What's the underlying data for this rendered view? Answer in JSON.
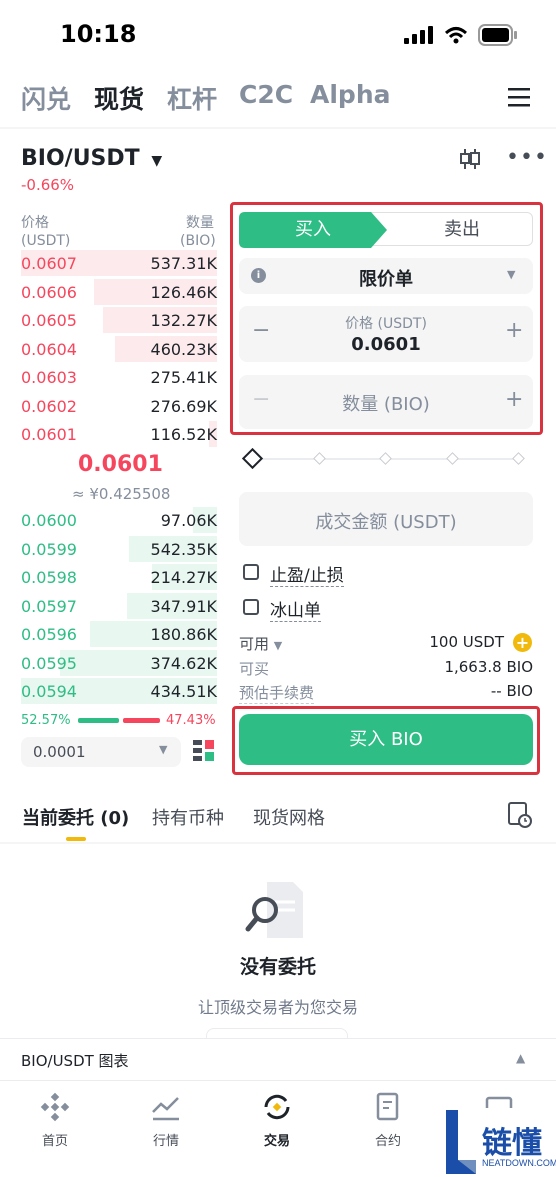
{
  "status": {
    "time": "10:18"
  },
  "top_tabs": [
    "闪兑",
    "现货",
    "杠杆",
    "C2C",
    "Alpha"
  ],
  "pair": {
    "symbol": "BIO/USDT",
    "change": "-0.66%"
  },
  "orderbook": {
    "price_label": "价格",
    "price_unit": "(USDT)",
    "qty_label": "数量",
    "qty_unit": "(BIO)",
    "asks": [
      {
        "price": "0.0607",
        "qty": "537.31K",
        "depth": 1.0
      },
      {
        "price": "0.0606",
        "qty": "126.46K",
        "depth": 0.63
      },
      {
        "price": "0.0605",
        "qty": "132.27K",
        "depth": 0.58
      },
      {
        "price": "0.0604",
        "qty": "460.23K",
        "depth": 0.52
      },
      {
        "price": "0.0603",
        "qty": "275.41K",
        "depth": 0
      },
      {
        "price": "0.0602",
        "qty": "276.69K",
        "depth": 0
      },
      {
        "price": "0.0601",
        "qty": "116.52K",
        "depth": 0.04
      }
    ],
    "mid_price": "0.0601",
    "mid_cny": "≈ ¥0.425508",
    "bids": [
      {
        "price": "0.0600",
        "qty": "97.06K",
        "depth": 0.12
      },
      {
        "price": "0.0599",
        "qty": "542.35K",
        "depth": 0.45
      },
      {
        "price": "0.0598",
        "qty": "214.27K",
        "depth": 0.33
      },
      {
        "price": "0.0597",
        "qty": "347.91K",
        "depth": 0.46
      },
      {
        "price": "0.0596",
        "qty": "180.86K",
        "depth": 0.65
      },
      {
        "price": "0.0595",
        "qty": "374.62K",
        "depth": 0.8
      },
      {
        "price": "0.0594",
        "qty": "434.51K",
        "depth": 1.0
      }
    ],
    "buy_ratio": "52.57%",
    "sell_ratio": "47.43%",
    "buy_fraction": 0.5257,
    "precision": "0.0001"
  },
  "form": {
    "buy_tab": "买入",
    "sell_tab": "卖出",
    "order_type": "限价单",
    "price_label": "价格 (USDT)",
    "price_value": "0.0601",
    "qty_placeholder": "数量 (BIO)",
    "amount_placeholder": "成交金额 (USDT)",
    "tpsl_label": "止盈/止损",
    "iceberg_label": "冰山单",
    "available_label": "可用",
    "available_value": "100 USDT",
    "can_buy_label": "可买",
    "can_buy_value": "1,663.8 BIO",
    "fee_label": "预估手续费",
    "fee_value": "-- BIO",
    "submit_label": "买入 BIO"
  },
  "orders": {
    "tabs": [
      "当前委托 (0)",
      "持有币种",
      "现货网格"
    ],
    "empty_title": "没有委托",
    "empty_subtitle": "让顶级交易者为您交易"
  },
  "chart_bar": {
    "label": "BIO/USDT 图表"
  },
  "bottom_nav": [
    "首页",
    "行情",
    "交易",
    "合约",
    ""
  ],
  "watermark": {
    "brand": "链懂",
    "site": "NEATDOWN.COM"
  },
  "colors": {
    "buy": "#2ebd85",
    "sell": "#f6465d",
    "accent": "#f0b90b",
    "highlight": "#d9333f"
  }
}
